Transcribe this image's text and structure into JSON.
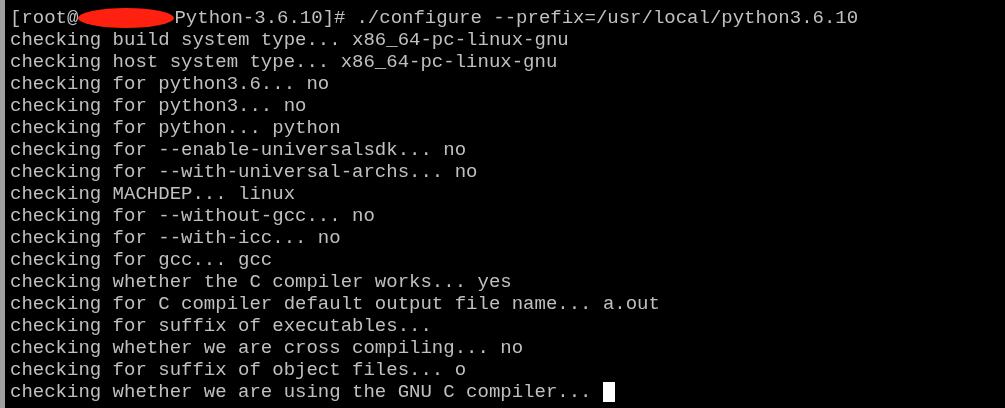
{
  "terminal": {
    "prompt": {
      "user": "[root@",
      "directory": "Python-3.6.10]#",
      "command": "./configure --prefix=/usr/local/python3.6.10"
    },
    "output": [
      "checking build system type... x86_64-pc-linux-gnu",
      "checking host system type... x86_64-pc-linux-gnu",
      "checking for python3.6... no",
      "checking for python3... no",
      "checking for python... python",
      "checking for --enable-universalsdk... no",
      "checking for --with-universal-archs... no",
      "checking MACHDEP... linux",
      "checking for --without-gcc... no",
      "checking for --with-icc... no",
      "checking for gcc... gcc",
      "checking whether the C compiler works... yes",
      "checking for C compiler default output file name... a.out",
      "checking for suffix of executables...",
      "checking whether we are cross compiling... no",
      "checking for suffix of object files... o",
      "checking whether we are using the GNU C compiler..."
    ]
  }
}
